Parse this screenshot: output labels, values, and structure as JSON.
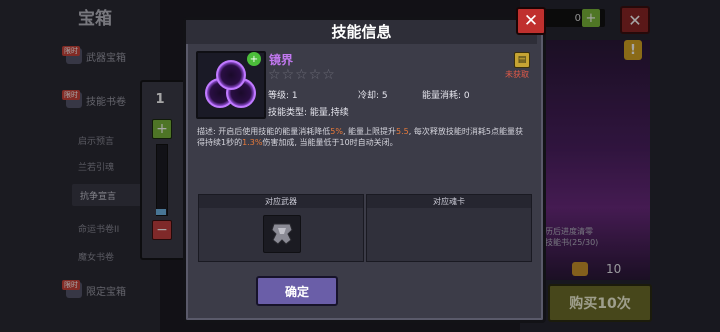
{
  "background": {
    "title": "宝箱",
    "categories": [
      {
        "label": "武器宝箱",
        "tag": "限时"
      },
      {
        "label": "技能书卷",
        "tag": "限时"
      },
      {
        "label": "限定宝箱",
        "tag": "限时"
      }
    ],
    "sub_items": [
      "启示预言",
      "兰若引魂",
      "抗争宣言",
      "命运书卷II",
      "魔女书卷"
    ],
    "active_sub": "抗争宣言",
    "coin_value": "0",
    "plus_label": "+",
    "close_label": "✕",
    "warn_label": "!",
    "progress_text1": "历后进度清零",
    "progress_text2": "技能书(25/30)",
    "price": "10",
    "buy_label": "购买10次"
  },
  "slider": {
    "value": "1",
    "plus": "+",
    "minus": "−",
    "level": 0.08
  },
  "dialog": {
    "title": "技能信息",
    "close_label": "✕",
    "skill": {
      "name": "镜界",
      "badge": "+",
      "stars_total": 5,
      "stars_filled": 0,
      "level_label": "等级: 1",
      "cooldown_label": "冷却: 5",
      "energy_label": "能量消耗: 0",
      "type_label": "技能类型: 能量,持续",
      "status": "未获取",
      "status_icon": "book-icon"
    },
    "description": {
      "p1": "描述: 开启后使用技能的能量消耗降低",
      "h1": "5%",
      "p2": ", 能量上限提升",
      "h2": "5.5",
      "p3": ", 每次释放技能时消耗5点能量获得持续1秒的",
      "h3": "1.3%",
      "p4": "伤害加成, 当能量低于10时自动关闭。"
    },
    "weapon_header": "对应武器",
    "card_header": "对应魂卡",
    "confirm_label": "确定"
  },
  "colors": {
    "skill_name": "#c278f0",
    "status": "#e25a48",
    "highlight": "#e87a3a",
    "confirm": "#6a5ea8",
    "close": "#c0302e"
  }
}
